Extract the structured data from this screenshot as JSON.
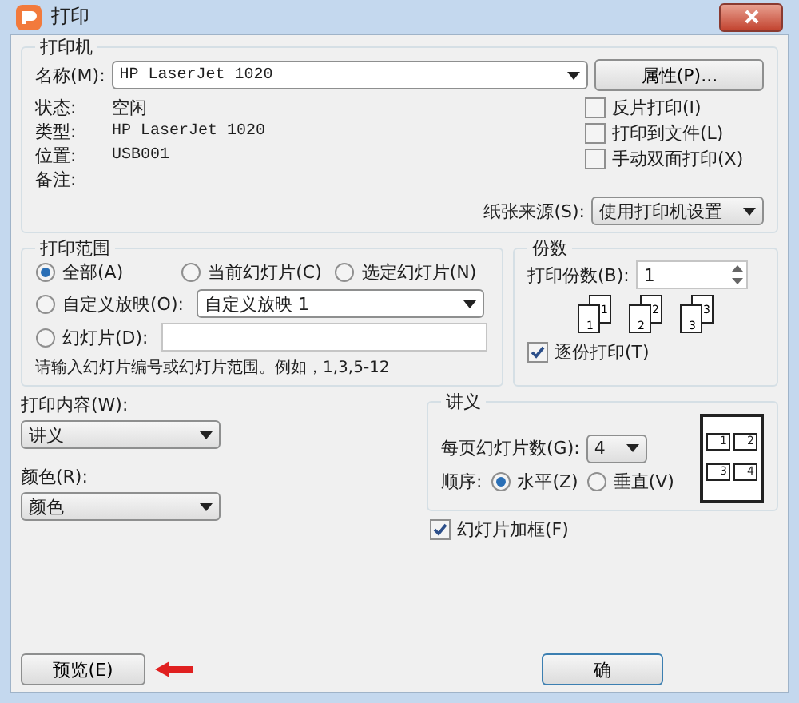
{
  "window": {
    "title": "打印"
  },
  "printer": {
    "legend": "打印机",
    "name_label": "名称(M):",
    "name_value": "HP LaserJet 1020",
    "properties_button": "属性(P)...",
    "info": [
      {
        "label": "状态:",
        "value": "空闲"
      },
      {
        "label": "类型:",
        "value": "HP LaserJet 1020"
      },
      {
        "label": "位置:",
        "value": "USB001"
      },
      {
        "label": "备注:"
      }
    ],
    "options": [
      {
        "label": "反片打印(I)",
        "checked": false
      },
      {
        "label": "打印到文件(L)",
        "checked": false
      },
      {
        "label": "手动双面打印(X)",
        "checked": false
      }
    ],
    "paper_source_label": "纸张来源(S):",
    "paper_source_value": "使用打印机设置"
  },
  "range": {
    "legend": "打印范围",
    "options": [
      {
        "label": "全部(A)",
        "selected": true
      },
      {
        "label": "当前幻灯片(C)",
        "selected": false
      },
      {
        "label": "选定幻灯片(N)",
        "selected": false
      },
      {
        "label": "自定义放映(O):",
        "selected": false
      },
      {
        "label": "幻灯片(D):",
        "selected": false
      }
    ],
    "custom_show_value": "自定义放映 1",
    "hint": "请输入幻灯片编号或幻灯片范围。例如，1,3,5-12"
  },
  "copies": {
    "legend": "份数",
    "count_label": "打印份数(B):",
    "count_value": "1",
    "collate_pages": [
      {
        "back": "1",
        "front": "1"
      },
      {
        "back": "2",
        "front": "2"
      },
      {
        "back": "3",
        "front": "3"
      }
    ],
    "collate": {
      "label": "逐份打印(T)",
      "checked": true
    }
  },
  "content_label": "打印内容(W):",
  "content_value": "讲义",
  "color_label": "颜色(R):",
  "color_value": "颜色",
  "handouts": {
    "legend": "讲义",
    "per_page_label": "每页幻灯片数(G):",
    "per_page_value": "4",
    "order_label": "顺序:",
    "order": [
      {
        "label": "水平(Z)",
        "selected": true
      },
      {
        "label": "垂直(V)",
        "selected": false
      }
    ],
    "preview_cells": [
      "1",
      "2",
      "3",
      "4"
    ]
  },
  "frame_slides": {
    "label": "幻灯片加框(F)",
    "checked": true
  },
  "buttons": [
    {
      "kind": "preview",
      "label": "预览(E)"
    },
    {
      "kind": "ok",
      "label": "确"
    }
  ]
}
